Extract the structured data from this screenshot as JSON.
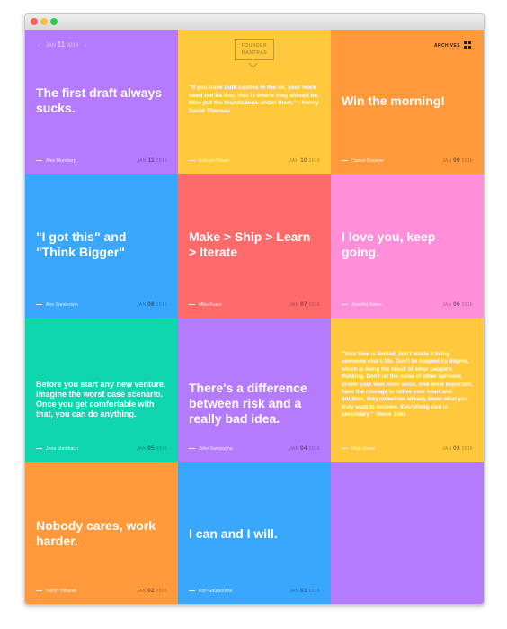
{
  "header": {
    "nav_prev": "‹",
    "nav_month": "JAN",
    "nav_day": "11",
    "nav_year": "2016",
    "nav_next": "›",
    "logo_line1": "FOUNDER",
    "logo_line2": "MANTRAS",
    "archives_label": "ARCHIVES",
    "archives_icon": "grid-icon"
  },
  "colors": {
    "purple": "#b57bff",
    "yellow": "#ffc83d",
    "orange": "#ff9a3c",
    "blue": "#3aa7ff",
    "red": "#ff6b6b",
    "pink": "#ff8fd8",
    "teal": "#10d6b0"
  },
  "tiles": [
    {
      "quote": "The first draft always sucks.",
      "author": "Alex Blumberg",
      "month": "JAN",
      "day": "11",
      "year": "2016"
    },
    {
      "quote": "\"If you have built castles in the air, your work need not be lost; that is where they should be. Now put the foundations under them.\" - Henry David Thoreau",
      "author": "Kathryn Brown",
      "month": "JAN",
      "day": "10",
      "year": "2016"
    },
    {
      "quote": "Win the morning!",
      "author": "Darren Buckner",
      "month": "JAN",
      "day": "09",
      "year": "2016"
    },
    {
      "quote": "\"I got this\" and \"Think Bigger\"",
      "author": "Ann Sanderson",
      "month": "JAN",
      "day": "08",
      "year": "2016"
    },
    {
      "quote": "Make > Ship > Learn > Iterate",
      "author": "Mike Arauz",
      "month": "JAN",
      "day": "07",
      "year": "2016"
    },
    {
      "quote": "I love you, keep going.",
      "author": "Jennifer Jones",
      "month": "JAN",
      "day": "06",
      "year": "2016"
    },
    {
      "quote": "Before you start any new venture, imagine the worst case scenario. Once you get comfortable with that, you can do anything.",
      "author": "Jena Steinbach",
      "month": "JAN",
      "day": "05",
      "year": "2016"
    },
    {
      "quote": "There's a difference between risk and a really bad idea.",
      "author": "John Sampogna",
      "month": "JAN",
      "day": "04",
      "year": "2016"
    },
    {
      "quote": "\"Your time is limited, don't waste it living someone else's life. Don't be trapped by dogma, which is living the result of other people's thinking. Don't let the noise of other opinions drown your own inner voice. And most important, have the courage to follow your heart and intuition, they somehow already know what you truly want to become. Everything else is secondary.\" -Steve Jobs",
      "author": "Nick Haase",
      "month": "JAN",
      "day": "03",
      "year": "2016"
    },
    {
      "quote": "Nobody cares, work harder.",
      "author": "Saron Yitbarek",
      "month": "JAN",
      "day": "02",
      "year": "2016"
    },
    {
      "quote": "I can and I will.",
      "author": "Kim Goulbourne",
      "month": "JAN",
      "day": "01",
      "year": "2016"
    }
  ]
}
